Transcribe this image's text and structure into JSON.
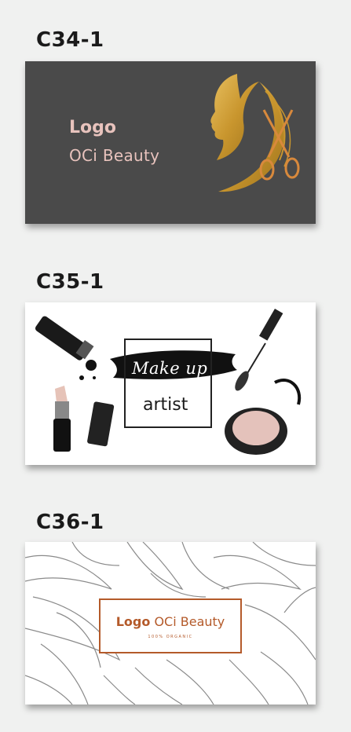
{
  "cards": [
    {
      "code": "C34-1",
      "logo_word": "Logo",
      "brand": "OCi Beauty"
    },
    {
      "code": "C35-1",
      "headline": "Make up",
      "subline": "artist"
    },
    {
      "code": "C36-1",
      "logo_word": "Logo",
      "brand": "OCi Beauty",
      "tagline": "100% ORGANIC"
    }
  ],
  "colors": {
    "page_bg": "#f0f1f0",
    "card1_bg": "#4a4a4a",
    "card1_text": "#e8c3bd",
    "gold": "#c9962e",
    "card3_accent": "#b45a2a"
  },
  "icons": [
    "woman-silhouette-icon",
    "scissors-icon",
    "mascara-icon",
    "lipstick-icon",
    "compact-powder-icon",
    "lily-flower-pattern"
  ]
}
